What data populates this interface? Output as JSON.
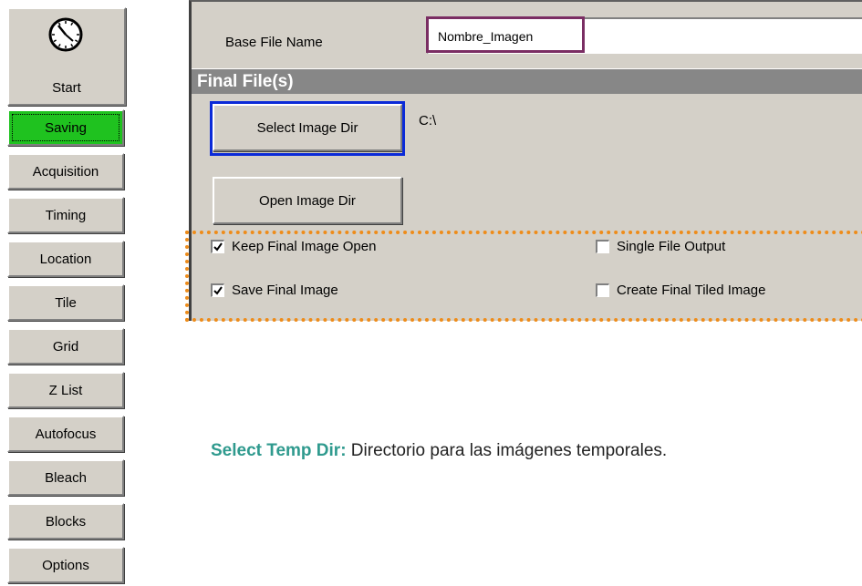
{
  "nav": {
    "start_label": "Start",
    "items": [
      {
        "label": "Saving",
        "active": true
      },
      {
        "label": "Acquisition"
      },
      {
        "label": "Timing"
      },
      {
        "label": "Location"
      },
      {
        "label": "Tile"
      },
      {
        "label": "Grid"
      },
      {
        "label": "Z List"
      },
      {
        "label": "Autofocus"
      },
      {
        "label": "Bleach"
      },
      {
        "label": "Blocks"
      },
      {
        "label": "Options"
      }
    ],
    "active_color": "#1fc21f"
  },
  "panel": {
    "base_file_label": "Base File Name",
    "base_file_value": "Nombre_Imagen",
    "section_title": "Final File(s)",
    "select_image_dir_label": "Select Image Dir",
    "image_dir_path": "C:\\",
    "open_image_dir_label": "Open Image Dir",
    "checkboxes": [
      {
        "label": "Keep Final Image Open",
        "checked": true
      },
      {
        "label": "Single File Output",
        "checked": false
      },
      {
        "label": "Save Final Image",
        "checked": true
      },
      {
        "label": "Create Final Tiled Image",
        "checked": false
      }
    ]
  },
  "annotation": {
    "key": "Select Temp Dir:",
    "text": " Directorio para las imágenes temporales.",
    "key_color": "#2f9a8e"
  },
  "highlights": {
    "purple": "#7a2d63",
    "blue": "#0a2ad8",
    "orange": "#ee8c1a"
  }
}
